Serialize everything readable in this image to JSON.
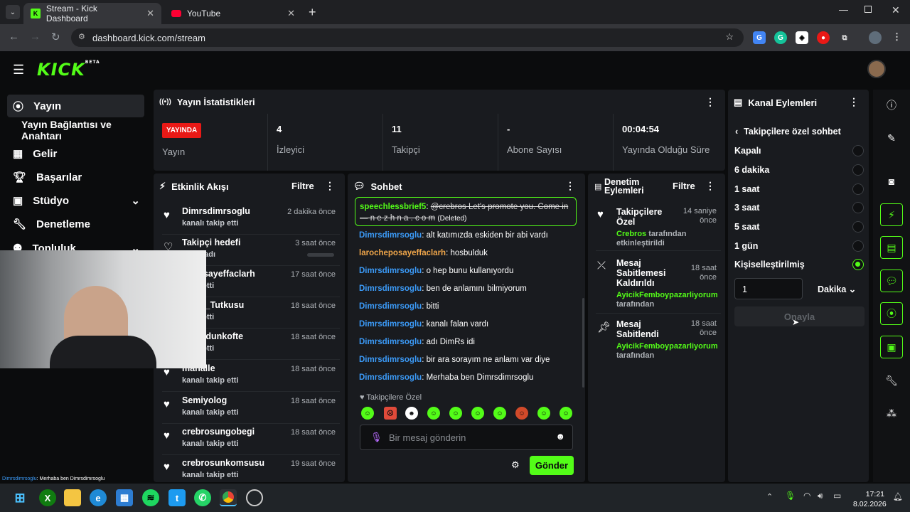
{
  "browser": {
    "tabs": [
      {
        "title": "Stream - Kick Dashboard"
      },
      {
        "title": "YouTube"
      }
    ],
    "url": "dashboard.kick.com/stream"
  },
  "app": {
    "logo": "KICK",
    "beta": "BETA"
  },
  "sidebar": {
    "items": [
      {
        "label": "Yayın",
        "icon": "broadcast-icon"
      },
      {
        "label": "Yayın Bağlantısı ve Anahtarı"
      },
      {
        "label": "Gelir",
        "icon": "chart-icon"
      },
      {
        "label": "Başarılar",
        "icon": "trophy-icon"
      },
      {
        "label": "Stüdyo",
        "icon": "studio-icon"
      },
      {
        "label": "Denetleme",
        "icon": "wrench-icon"
      },
      {
        "label": "Topluluk",
        "icon": "users-icon"
      }
    ]
  },
  "stats": {
    "title": "Yayın İstatistikleri",
    "live_badge": "YAYINDA",
    "live_label": "Yayın",
    "items": [
      {
        "value": "4",
        "label": "İzleyici"
      },
      {
        "value": "11",
        "label": "Takipçi"
      },
      {
        "value": "-",
        "label": "Abone Sayısı"
      },
      {
        "value": "00:04:54",
        "label": "Yayında Olduğu Süre"
      }
    ]
  },
  "activity": {
    "title": "Etkinlik Akışı",
    "filter": "Filtre",
    "events": [
      {
        "name": "Dimrsdimrsoglu",
        "sub": "kanalı takip etti",
        "time": "2 dakika önce"
      },
      {
        "name": "Takipçi hedefi",
        "sub": "e başladı",
        "time": "3 saat önce"
      },
      {
        "name": "heposayeffaclarh",
        "sub": "takip etti",
        "time": "17 saat önce"
      },
      {
        "name": "siyon_Tutkusu",
        "sub": "takip etti",
        "time": "18 saat önce"
      },
      {
        "name": "menodunkofte",
        "sub": "takip etti",
        "time": "18 saat önce"
      },
      {
        "name": "manalle",
        "sub": "kanalı takip etti",
        "time": "18 saat önce"
      },
      {
        "name": "Semiyolog",
        "sub": "kanalı takip etti",
        "time": "18 saat önce"
      },
      {
        "name": "crebrosungobegi",
        "sub": "kanalı takip etti",
        "time": "18 saat önce"
      },
      {
        "name": "crebrosunkomsusu",
        "sub": "kanalı takip etti",
        "time": "19 saat önce"
      }
    ]
  },
  "chat": {
    "title": "Sohbet",
    "pinned": {
      "user": "speechlessbrief5",
      "text": "@crebros Let's promote you. Come in — n e z h n a . c o m",
      "deleted": "(Deleted)"
    },
    "messages": [
      {
        "user": "Dimrsdimrsoglu",
        "text": "alt katımızda eskiden bir abi vardı",
        "color": "#3b9af7"
      },
      {
        "user": "larocheposayeffaclarh",
        "text": "hosbulduk",
        "color": "#f0a64a"
      },
      {
        "user": "Dimrsdimrsoglu",
        "text": "o hep bunu kullanıyordu",
        "color": "#3b9af7"
      },
      {
        "user": "Dimrsdimrsoglu",
        "text": "ben de anlamını bilmiyorum",
        "color": "#3b9af7"
      },
      {
        "user": "Dimrsdimrsoglu",
        "text": "bitti",
        "color": "#3b9af7"
      },
      {
        "user": "Dimrsdimrsoglu",
        "text": "kanalı falan vardı",
        "color": "#3b9af7"
      },
      {
        "user": "Dimrsdimrsoglu",
        "text": "adı DimRs idi",
        "color": "#3b9af7"
      },
      {
        "user": "Dimrsdimrsoglu",
        "text": "bir ara sorayım ne anlamı var diye",
        "color": "#3b9af7"
      },
      {
        "user": "Dimrsdimrsoglu",
        "text": "Merhaba ben Dimrsdimrsoglu",
        "color": "#3b9af7"
      }
    ],
    "followers_only": "Takipçilere Özel",
    "placeholder": "Bir mesaj gönderin",
    "send": "Gönder"
  },
  "moderation": {
    "title_line1": "Denetim",
    "title_line2": "Eylemleri",
    "filter": "Filtre",
    "items": [
      {
        "icon": "heart-icon",
        "lines": [
          "Takipçilere",
          "Özel"
        ],
        "time": [
          "14 saniye",
          "önce"
        ],
        "by_user": "Crebros",
        "by": [
          "tarafından",
          "etkinleştirildi"
        ]
      },
      {
        "icon": "unpin-icon",
        "lines": [
          "Mesaj",
          "Sabitlemesi",
          "Kaldırıldı"
        ],
        "time": [
          "18 saat",
          "önce"
        ],
        "by_user": "AyicikFemboypazarliyorum",
        "by": [
          "tarafından"
        ]
      },
      {
        "icon": "pin-icon",
        "lines": [
          "Mesaj",
          "Sabitlendi"
        ],
        "time": [
          "18 saat",
          "önce"
        ],
        "by_user": "AyicikFemboypazarliyorum",
        "by": [
          "tarafından"
        ]
      }
    ]
  },
  "channel": {
    "title": "Kanal Eylemleri",
    "sub": "Takipçilere özel sohbet",
    "options": [
      {
        "label": "Kapalı"
      },
      {
        "label": "6 dakika"
      },
      {
        "label": "1 saat"
      },
      {
        "label": "3 saat"
      },
      {
        "label": "5 saat"
      },
      {
        "label": "1 gün"
      },
      {
        "label": "Kişiselleştirilmiş",
        "selected": true
      }
    ],
    "custom_value": "1",
    "unit": "Dakika",
    "confirm": "Onayla"
  },
  "overlay_text": {
    "user": "Dimrsdimrsoglu",
    "text": ": Merhaba ben Dimrsdimrsoglu"
  },
  "taskbar": {
    "time": "17:21",
    "date": "8.02.2026"
  },
  "colors": {
    "accent": "#53fc18",
    "live": "#e91916",
    "panel": "#191b1f"
  }
}
